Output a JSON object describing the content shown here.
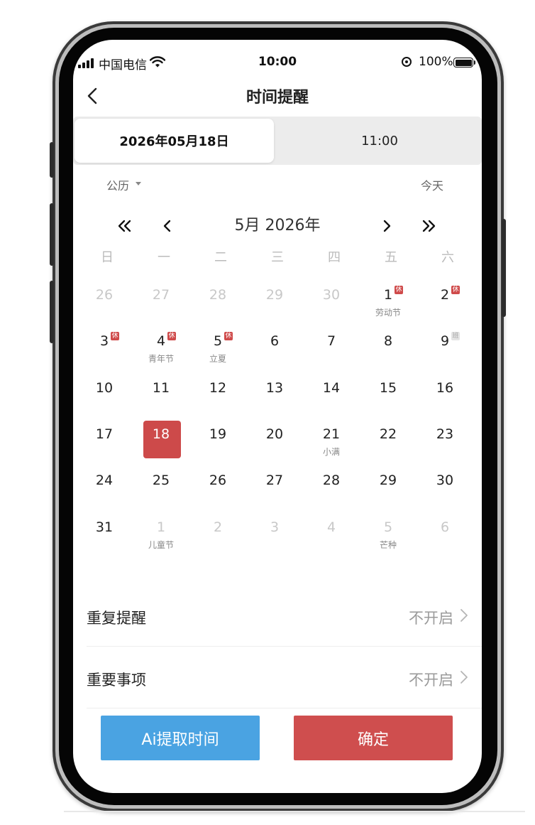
{
  "status_bar": {
    "carrier": "中国电信",
    "time": "10:00",
    "battery": "100%"
  },
  "nav": {
    "title": "时间提醒"
  },
  "segment": {
    "date": "2026年05月18日",
    "time": "11:00"
  },
  "calendar": {
    "type_label": "公历",
    "today_label": "今天",
    "month_title": "5月 2026年",
    "weekdays": [
      "日",
      "一",
      "二",
      "三",
      "四",
      "五",
      "六"
    ],
    "rest_badge": "休",
    "work_badge": "班",
    "days": [
      {
        "n": "26",
        "other": true
      },
      {
        "n": "27",
        "other": true
      },
      {
        "n": "28",
        "other": true
      },
      {
        "n": "29",
        "other": true
      },
      {
        "n": "30",
        "other": true
      },
      {
        "n": "1",
        "badge": "rest",
        "sub": "劳动节"
      },
      {
        "n": "2",
        "badge": "rest"
      },
      {
        "n": "3",
        "badge": "rest"
      },
      {
        "n": "4",
        "badge": "rest",
        "sub": "青年节"
      },
      {
        "n": "5",
        "badge": "rest",
        "sub": "立夏"
      },
      {
        "n": "6"
      },
      {
        "n": "7"
      },
      {
        "n": "8"
      },
      {
        "n": "9",
        "badge": "work"
      },
      {
        "n": "10"
      },
      {
        "n": "11"
      },
      {
        "n": "12"
      },
      {
        "n": "13"
      },
      {
        "n": "14"
      },
      {
        "n": "15"
      },
      {
        "n": "16"
      },
      {
        "n": "17"
      },
      {
        "n": "18",
        "selected": true
      },
      {
        "n": "19"
      },
      {
        "n": "20"
      },
      {
        "n": "21",
        "sub": "小满"
      },
      {
        "n": "22"
      },
      {
        "n": "23"
      },
      {
        "n": "24"
      },
      {
        "n": "25"
      },
      {
        "n": "26"
      },
      {
        "n": "27"
      },
      {
        "n": "28"
      },
      {
        "n": "29"
      },
      {
        "n": "30"
      },
      {
        "n": "31"
      },
      {
        "n": "1",
        "other": true,
        "sub": "儿童节"
      },
      {
        "n": "2",
        "other": true
      },
      {
        "n": "3",
        "other": true
      },
      {
        "n": "4",
        "other": true
      },
      {
        "n": "5",
        "other": true,
        "sub": "芒种"
      },
      {
        "n": "6",
        "other": true
      }
    ]
  },
  "settings": {
    "repeat_label": "重复提醒",
    "repeat_value": "不开启",
    "important_label": "重要事项",
    "important_value": "不开启"
  },
  "buttons": {
    "ai_label": "Ai提取时间",
    "confirm_label": "确定"
  },
  "colors": {
    "accent_red": "#cf4e4e",
    "accent_blue": "#4aa3e2"
  }
}
